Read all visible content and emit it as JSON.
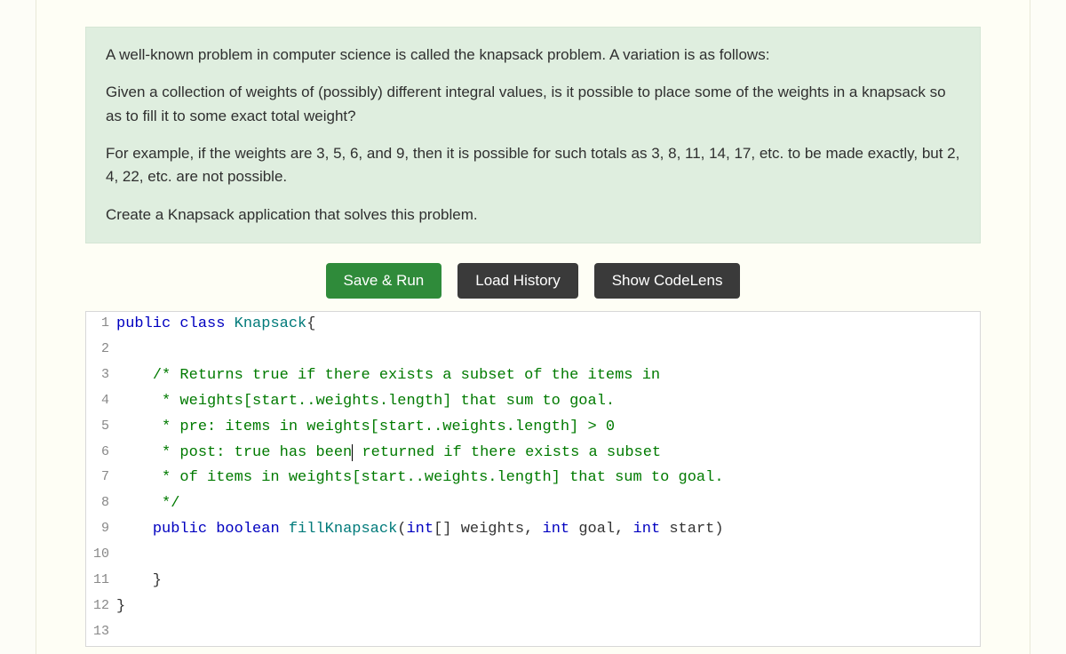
{
  "problem": {
    "p1": "A well-known problem in computer science is called the knapsack problem. A variation is as follows:",
    "p2": "Given a collection of weights of (possibly) different integral values, is it possible to place some of the weights in a knapsack so as to fill it to some exact total weight?",
    "p3": "For example, if the weights are 3, 5, 6, and 9, then it is possible for such totals as 3, 8, 11, 14, 17, etc. to be made exactly, but 2, 4, 22, etc. are not possible.",
    "p4": "Create a Knapsack application that solves this problem."
  },
  "buttons": {
    "save_run": "Save & Run",
    "load_history": "Load History",
    "show_codelens": "Show CodeLens"
  },
  "code": {
    "lines": [
      {
        "n": "1",
        "segments": [
          {
            "t": "public",
            "c": "kw"
          },
          {
            "t": " "
          },
          {
            "t": "class",
            "c": "kw"
          },
          {
            "t": " "
          },
          {
            "t": "Knapsack",
            "c": "cls"
          },
          {
            "t": "{"
          }
        ]
      },
      {
        "n": "2",
        "segments": []
      },
      {
        "n": "3",
        "segments": [
          {
            "t": "    "
          },
          {
            "t": "/* Returns true if there exists a subset of the items in",
            "c": "cmt"
          }
        ]
      },
      {
        "n": "4",
        "segments": [
          {
            "t": "     "
          },
          {
            "t": "* weights[start..weights.length] that sum to goal.",
            "c": "cmt"
          }
        ]
      },
      {
        "n": "5",
        "segments": [
          {
            "t": "     "
          },
          {
            "t": "* pre: items in weights[start..weights.length] > 0",
            "c": "cmt"
          }
        ]
      },
      {
        "n": "6",
        "segments": [
          {
            "t": "     "
          },
          {
            "t": "* post: true has been",
            "c": "cmt"
          },
          {
            "cursor": true
          },
          {
            "t": " returned if there exists a subset",
            "c": "cmt"
          }
        ]
      },
      {
        "n": "7",
        "segments": [
          {
            "t": "     "
          },
          {
            "t": "* of items in weights[start..weights.length] that sum to goal.",
            "c": "cmt"
          }
        ]
      },
      {
        "n": "8",
        "segments": [
          {
            "t": "     "
          },
          {
            "t": "*/",
            "c": "cmt"
          }
        ]
      },
      {
        "n": "9",
        "segments": [
          {
            "t": "    "
          },
          {
            "t": "public",
            "c": "kw"
          },
          {
            "t": " "
          },
          {
            "t": "boolean",
            "c": "kw"
          },
          {
            "t": " "
          },
          {
            "t": "fillKnapsack",
            "c": "cls"
          },
          {
            "t": "("
          },
          {
            "t": "int",
            "c": "kw"
          },
          {
            "t": "[] weights, "
          },
          {
            "t": "int",
            "c": "kw"
          },
          {
            "t": " goal, "
          },
          {
            "t": "int",
            "c": "kw"
          },
          {
            "t": " start)"
          }
        ]
      },
      {
        "n": "10",
        "segments": []
      },
      {
        "n": "11",
        "segments": [
          {
            "t": "    }"
          }
        ]
      },
      {
        "n": "12",
        "segments": [
          {
            "t": "}"
          }
        ]
      },
      {
        "n": "13",
        "segments": []
      }
    ]
  }
}
